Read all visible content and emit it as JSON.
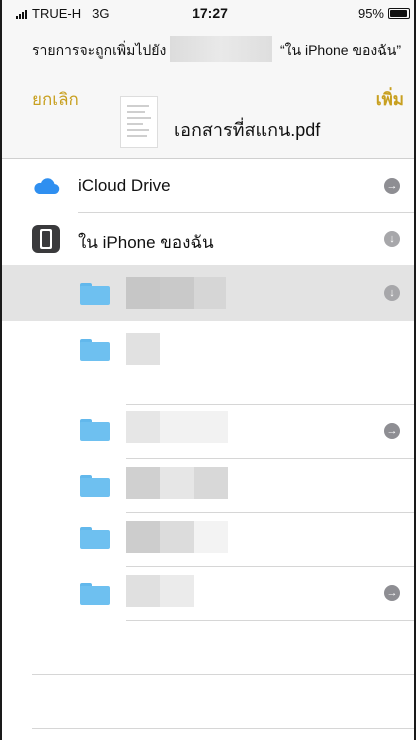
{
  "status_bar": {
    "carrier": "TRUE-H",
    "network": "3G",
    "time": "17:27",
    "battery": "95%",
    "battery_level": 0.95
  },
  "header": {
    "destination_prefix": "รายการจะถูกเพิ่มไปยัง",
    "destination_suffix": "“ใน iPhone ของฉัน”",
    "cancel_label": "ยกเลิก",
    "add_label": "เพิ่ม",
    "document_name": "เอกสารที่สแกน.pdf"
  },
  "locations": [
    {
      "label": "iCloud Drive",
      "icon": "cloud-icon",
      "accessory": "arrow-right-circle-icon"
    },
    {
      "label": "ใน iPhone ของฉัน",
      "icon": "iphone-icon",
      "accessory": "arrow-down-circle-icon"
    }
  ],
  "folders": [
    {
      "icon": "folder-icon",
      "name_blurred": true,
      "selected": true,
      "accessory": "arrow-down-circle-icon"
    },
    {
      "icon": "folder-icon",
      "name_blurred": true,
      "selected": false,
      "accessory": null
    },
    {
      "icon": "folder-icon",
      "name_blurred": true,
      "selected": false,
      "accessory": "arrow-right-circle-icon"
    },
    {
      "icon": "folder-icon",
      "name_blurred": true,
      "selected": false,
      "accessory": null
    },
    {
      "icon": "folder-icon",
      "name_blurred": true,
      "selected": false,
      "accessory": null
    },
    {
      "icon": "folder-icon",
      "name_blurred": true,
      "selected": false,
      "accessory": "arrow-right-circle-icon"
    }
  ],
  "colors": {
    "accent": "#c8a020",
    "folder": "#6ec0f0",
    "selected_row": "#e3e3e3",
    "icloud": "#2f8ff0"
  }
}
